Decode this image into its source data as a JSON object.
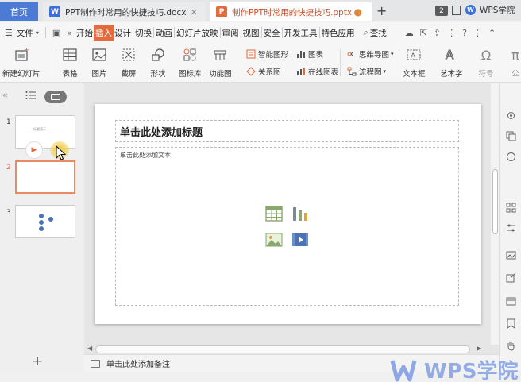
{
  "tabs": {
    "home": "首页",
    "doc1": {
      "title": "PPT制作时常用的快捷技巧.docx",
      "icon_letter": "W",
      "icon_color": "#3d6fd9"
    },
    "doc2": {
      "title": "制作PPT时常用的快捷技巧.pptx",
      "icon_letter": "P",
      "icon_color": "#e46b3d"
    },
    "tab_count": "2",
    "wps_academy": "WPS学院"
  },
  "menu": {
    "file": "文件",
    "items": [
      "开始",
      "插入",
      "设计",
      "切换",
      "动画",
      "幻灯片放映",
      "审阅",
      "视图",
      "安全",
      "开发工具",
      "特色应用"
    ],
    "active": "插入",
    "search": "查找"
  },
  "ribbon": {
    "new_slide": "新建幻灯片",
    "table": "表格",
    "picture": "图片",
    "screenshot": "截屏",
    "shape": "形状",
    "icon_lib": "图标库",
    "func_chart": "功能图",
    "smart_art": "智能图形",
    "chart": "图表",
    "relation": "关系图",
    "online_chart": "在线图表",
    "mind_map": "思维导图",
    "flow_chart": "流程图",
    "textbox": "文本框",
    "art_text": "艺术字",
    "symbol": "符号",
    "formula": "公"
  },
  "slides": [
    {
      "num": "1",
      "title": "标题演示"
    },
    {
      "num": "2"
    },
    {
      "num": "3"
    }
  ],
  "slide": {
    "title_placeholder": "单击此处添加标题",
    "content_placeholder": "单击此处添加文本"
  },
  "notes_placeholder": "单击此处添加备注",
  "watermark": "WPS学院",
  "colors": {
    "accent": "#e46b3d",
    "brand_blue": "#4b7bd5"
  }
}
